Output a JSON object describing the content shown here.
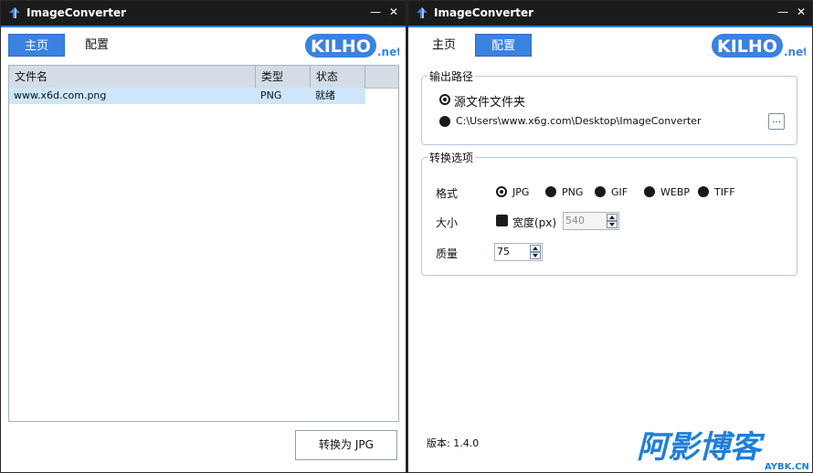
{
  "colors": {
    "accent": "#3a82e0",
    "titlebar": "#1b1b1b",
    "header": "#d4dce6",
    "selected_row": "#cde6fb"
  },
  "left_window": {
    "title": "ImageConverter",
    "nav": {
      "home": "主页",
      "config": "配置"
    },
    "logo": {
      "text": "KILHO",
      "suffix": ".net"
    },
    "table": {
      "columns": [
        "文件名",
        "类型",
        "状态"
      ],
      "rows": [
        {
          "file": "www.x6d.com.png",
          "type": "PNG",
          "status": "就绪"
        }
      ]
    },
    "convert_button": "转换为 JPG",
    "icons": {
      "app": "up-arrow-icon",
      "minimize": "minimize-icon",
      "close": "close-icon"
    }
  },
  "right_window": {
    "title": "ImageConverter",
    "nav": {
      "home": "主页",
      "config": "配置"
    },
    "logo": {
      "text": "KILHO",
      "suffix": ".net"
    },
    "output_path": {
      "title": "输出路径",
      "option_source": "源文件文件夹",
      "option_custom_path": "C:\\Users\\www.x6g.com\\Desktop\\ImageConverter",
      "browse": "...",
      "selected": "source"
    },
    "convert_options": {
      "title": "转换选项",
      "format_label": "格式",
      "formats": [
        "JPG",
        "PNG",
        "GIF",
        "WEBP",
        "TIFF"
      ],
      "selected_format": "JPG",
      "size_label": "大小",
      "width_checkbox": "宽度(px)",
      "width_value": "540",
      "quality_label": "质量",
      "quality_value": "75"
    },
    "version": "版本: 1.4.0",
    "watermark": {
      "main": "阿影博客",
      "sub": "AYBK.CN"
    }
  }
}
